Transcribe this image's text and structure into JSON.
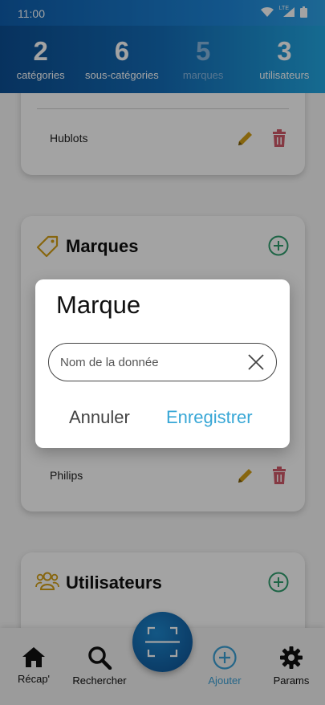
{
  "status": {
    "time": "11:00",
    "network": "LTE"
  },
  "stats": [
    {
      "count": "2",
      "label": "catégories"
    },
    {
      "count": "6",
      "label": "sous-catégories"
    },
    {
      "count": "5",
      "label": "marques"
    },
    {
      "count": "3",
      "label": "utilisateurs"
    }
  ],
  "subcategories_card": {
    "last_item": "Hublots"
  },
  "brands_card": {
    "title": "Marques",
    "last_item": "Philips"
  },
  "users_card": {
    "title": "Utilisateurs"
  },
  "dialog": {
    "title": "Marque",
    "input_placeholder": "Nom de la donnée",
    "input_value": "",
    "cancel_label": "Annuler",
    "save_label": "Enregistrer"
  },
  "bottom_nav": [
    {
      "label": "Récap'",
      "icon": "home-icon"
    },
    {
      "label": "Rechercher",
      "icon": "search-icon"
    },
    {
      "label": "Ajouter",
      "icon": "add-circle-icon",
      "active": true
    },
    {
      "label": "Params",
      "icon": "gear-icon"
    }
  ],
  "colors": {
    "accent": "#38a7d6",
    "edit": "#d4a017",
    "delete": "#d05a6a",
    "add": "#2f9e6e",
    "header": "#146db8"
  }
}
